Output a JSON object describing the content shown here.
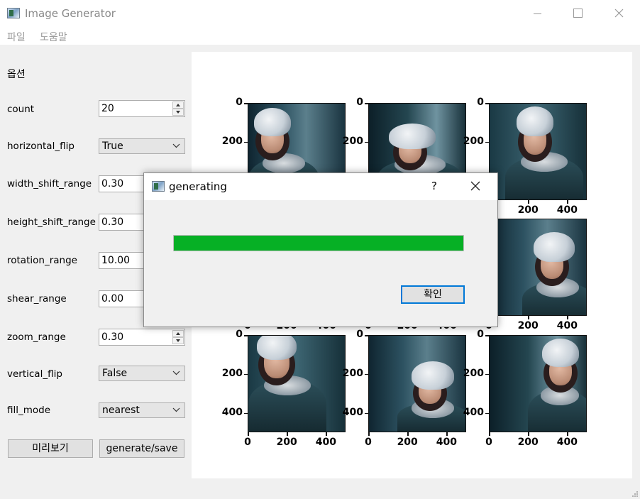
{
  "window": {
    "title": "Image Generator"
  },
  "menu": [
    "파일",
    "도움말"
  ],
  "options": {
    "section_title": "옵션",
    "count": {
      "label": "count",
      "value": "20"
    },
    "horizontal_flip": {
      "label": "horizontal_flip",
      "value": "True"
    },
    "width_shift_range": {
      "label": "width_shift_range",
      "value": "0.30"
    },
    "height_shift_range": {
      "label": "height_shift_range",
      "value": "0.30"
    },
    "rotation_range": {
      "label": "rotation_range",
      "value": "10.00"
    },
    "shear_range": {
      "label": "shear_range",
      "value": "0.00"
    },
    "zoom_range": {
      "label": "zoom_range",
      "value": "0.30"
    },
    "vertical_flip": {
      "label": "vertical_flip",
      "value": "False"
    },
    "fill_mode": {
      "label": "fill_mode",
      "value": "nearest"
    }
  },
  "buttons": {
    "preview": "미리보기",
    "generate": "generate/save"
  },
  "plot": {
    "y_ticks": [
      "0",
      "200",
      "400"
    ],
    "x_ticks": [
      "0",
      "200",
      "400"
    ]
  },
  "dialog": {
    "title": "generating",
    "help": "?",
    "progress_fraction": 1.0,
    "progress_color": "#06b025",
    "ok_label": "확인"
  },
  "icons": [
    "app-icon",
    "minimize-icon",
    "maximize-icon",
    "close-icon",
    "help-icon",
    "chevron-down-icon",
    "spin-up-icon",
    "spin-down-icon",
    "resize-grip-icon"
  ]
}
